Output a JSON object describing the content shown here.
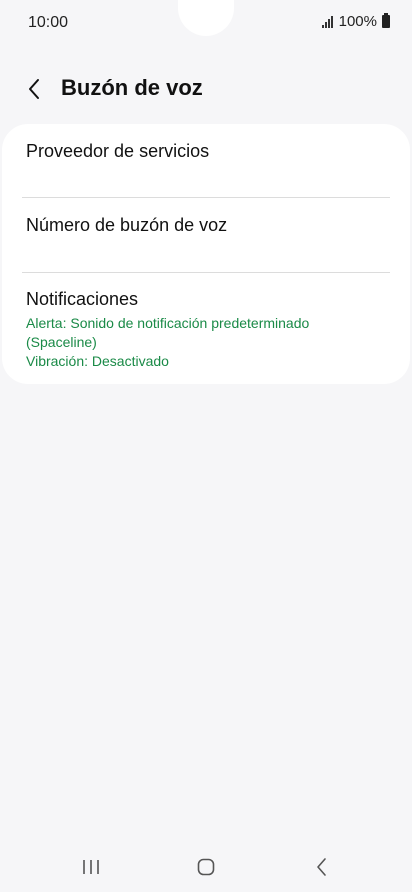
{
  "status_bar": {
    "time": "10:00",
    "battery": "100%",
    "signal_icon": "signal-bars-icon",
    "battery_icon": "battery-full-icon"
  },
  "header": {
    "back_icon": "chevron-left-icon",
    "title": "Buzón de voz"
  },
  "settings": {
    "items": [
      {
        "label": "Proveedor de servicios"
      },
      {
        "label": "Número de buzón de voz"
      },
      {
        "label": "Notificaciones",
        "detail_1": "Alerta: Sonido de notificación predeterminado (Spaceline)",
        "detail_2": "Vibración: Desactivado"
      }
    ]
  },
  "nav_bar": {
    "recents_icon": "recents-icon",
    "home_icon": "home-icon",
    "back_icon": "back-icon"
  },
  "colors": {
    "background": "#f6f6f8",
    "card": "#ffffff",
    "accent_green": "#1a8a47"
  }
}
